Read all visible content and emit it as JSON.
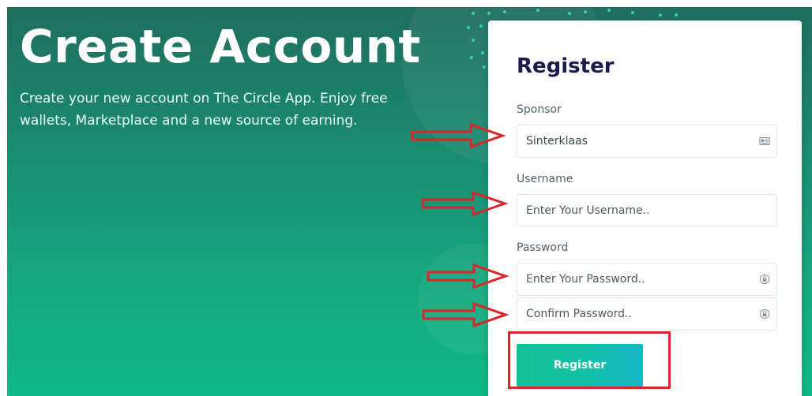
{
  "hero": {
    "title": "Create Account",
    "description": "Create your new account on The Circle App. Enjoy free wallets, Marketplace and a new source of earning."
  },
  "form": {
    "title": "Register",
    "sponsor": {
      "label": "Sponsor",
      "value": "Sinterklaas"
    },
    "username": {
      "label": "Username",
      "placeholder": "Enter Your Username.."
    },
    "password": {
      "label": "Password",
      "placeholder": "Enter Your Password.."
    },
    "confirm": {
      "placeholder": "Confirm Password.."
    },
    "submit_label": "Register"
  },
  "icons": {
    "sponsor_field": "id-card-icon",
    "password_field": "lock-icon",
    "confirm_field": "lock-icon"
  },
  "colors": {
    "background_top": "#1f6e5e",
    "background_bottom": "#10b985",
    "title_text": "#1d1a4e",
    "button_start": "#12c295",
    "button_end": "#16b7c8",
    "annotation": "#d9262b"
  }
}
